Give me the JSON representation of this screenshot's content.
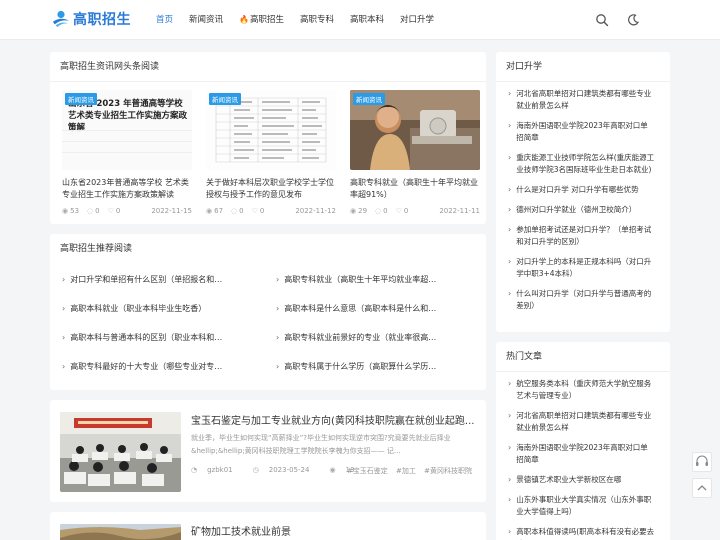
{
  "header": {
    "logo_text": "高职招生",
    "nav": [
      {
        "label": "首页",
        "active": true,
        "hot": false
      },
      {
        "label": "新闻资讯",
        "active": false,
        "hot": false
      },
      {
        "label": "高职招生",
        "active": false,
        "hot": true
      },
      {
        "label": "高职专科",
        "active": false,
        "hot": false
      },
      {
        "label": "高职本科",
        "active": false,
        "hot": false
      },
      {
        "label": "对口升学",
        "active": false,
        "hot": false
      }
    ],
    "icons": [
      "search-icon",
      "moon-icon"
    ]
  },
  "headlines": {
    "title": "高职招生资讯网头条阅读",
    "cards": [
      {
        "tag": "新闻资讯",
        "img_text": "山东省 2023 年普通高等学校 艺术类专业招生工作实施方案政策解",
        "title": "山东省2023年普通高等学校 艺术类专业招生工作实施方案政策解读",
        "views": "53",
        "comments": "0",
        "likes": "0",
        "date": "2022-11-15"
      },
      {
        "tag": "新闻资讯",
        "title": "关于做好本科层次职业学校学士学位授权与授予工作的意见发布",
        "views": "67",
        "comments": "0",
        "likes": "0",
        "date": "2022-11-12"
      },
      {
        "tag": "新闻资讯",
        "title": "高职专科就业（高职生十年平均就业率超91%）",
        "views": "29",
        "comments": "0",
        "likes": "0",
        "date": "2022-11-11"
      }
    ]
  },
  "recommend": {
    "title": "高职招生推荐阅读",
    "items": [
      "对口升学和单招有什么区别（单招报名和…",
      "高职专科就业（高职生十年平均就业率超…",
      "高职本科就业（职业本科毕业生吃香）",
      "高职本科是什么意思（高职本科是什么和…",
      "高职本科与普通本科的区别（职业本科和…",
      "高职专科就业前景好的专业（就业率很高…",
      "高职专科最好的十大专业（哪些专业对专…",
      "高职专科属于什么学历（高职算什么学历…"
    ]
  },
  "articles": [
    {
      "title": "宝玉石鉴定与加工专业就业方向(黄冈科技职院赢在就创业起跑...",
      "desc": "就业季，毕业生如何实现“高薪择业”?毕业生如何实现逆市突围?究竟要先就业后择业&hellip;&hellip;黄冈科技职院理工学院院长李槐为你支招——  记...",
      "author": "gzbk01",
      "date": "2023-05-24",
      "views": "13",
      "tags": [
        "#宝玉石鉴定",
        "#加工",
        "#黄冈科技职院"
      ]
    },
    {
      "title": "矿物加工技术就业前景"
    }
  ],
  "sidebar_duikou": {
    "title": "对口升学",
    "items": [
      "河北省高职单招对口建筑类都有哪些专业就业前景怎么样",
      "海南外国语职业学院2023年高职对口单招简章",
      "重庆能源工业技师学院怎么样(重庆能源工业技师学院3名国际班毕业生赴日本就业)",
      "什么是对口升学 对口升学有哪些优势",
      "德州对口升学就业（德州卫校简介）",
      "参加单招考试还是对口升学？（单招考试和对口升学的区别）",
      "对口升学上的本科是正规本科吗（对口升学中职3+4本科）",
      "什么叫对口升学（对口升学与普通高考的差别）"
    ]
  },
  "sidebar_hot": {
    "title": "热门文章",
    "items": [
      "航空服务类本科（重庆师范大学航空服务艺术与管理专业）",
      "河北省高职单招对口建筑类都有哪些专业就业前景怎么样",
      "海南外国语职业学院2023年高职对口单招简章",
      "景德镇艺术职业大学新校区在哪",
      "山东外事职业大学真实情况（山东外事职业大学值得上吗）",
      "高职本科值得读吗(职高本科有没有必要去读)"
    ]
  },
  "colors": {
    "accent": "#2b7ad8",
    "tag_bg": "#2b9be8",
    "hot": "#e94b3c"
  }
}
